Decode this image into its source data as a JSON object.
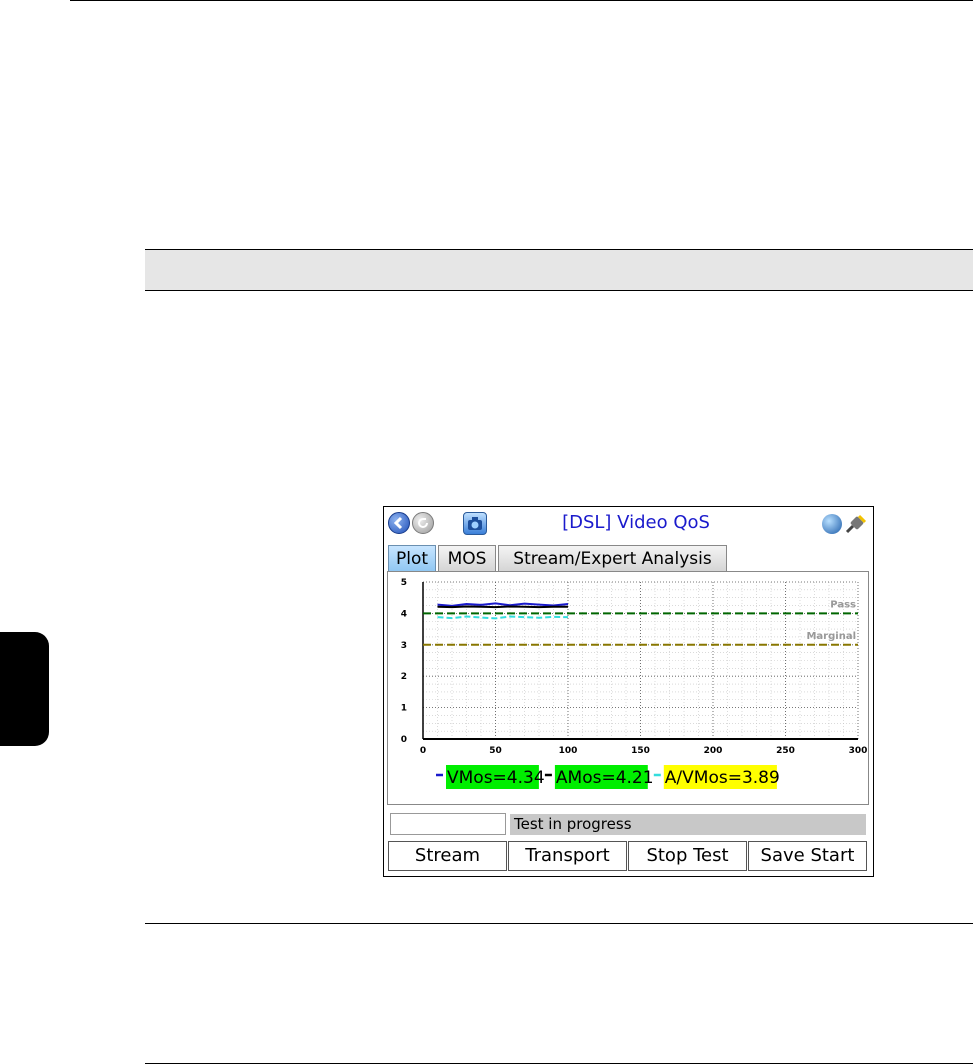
{
  "app": {
    "title": "[DSL] Video QoS",
    "icons": [
      "back-icon",
      "refresh-icon",
      "camera-icon",
      "globe-icon",
      "plug-icon"
    ]
  },
  "tabs": [
    {
      "label": "Plot",
      "active": true
    },
    {
      "label": "MOS",
      "active": false
    },
    {
      "label": "Stream/Expert Analysis",
      "active": false
    }
  ],
  "status": {
    "input_value": "",
    "message": "Test in progress"
  },
  "buttons": {
    "stream": "Stream",
    "transport": "Transport",
    "stop_test": "Stop Test",
    "save_start": "Save Start"
  },
  "legend": [
    {
      "label": "VMos=4.34",
      "swatch_color": "#1a1acc",
      "bg": "#00ee00"
    },
    {
      "label": "AMos=4.21",
      "swatch_color": "#000000",
      "bg": "#00ee00"
    },
    {
      "label": "A/VMos=3.89",
      "swatch_color": "#33dddd",
      "bg": "#ffff00"
    }
  ],
  "chart_data": {
    "type": "line",
    "title": "",
    "xlabel": "",
    "ylabel": "",
    "xlim": [
      0,
      300
    ],
    "ylim": [
      0,
      5
    ],
    "x_ticks": [
      0,
      50,
      100,
      150,
      200,
      250,
      300
    ],
    "y_ticks": [
      0,
      1,
      2,
      3,
      4,
      5
    ],
    "grid": true,
    "thresholds": [
      {
        "label": "Pass",
        "value": 4,
        "color": "#006600"
      },
      {
        "label": "Marginal",
        "value": 3,
        "color": "#887700"
      }
    ],
    "series": [
      {
        "name": "VMos",
        "color": "#1a1acc",
        "x": [
          10,
          20,
          30,
          40,
          50,
          60,
          70,
          80,
          90,
          100
        ],
        "y": [
          4.28,
          4.24,
          4.3,
          4.27,
          4.32,
          4.26,
          4.31,
          4.28,
          4.25,
          4.3
        ]
      },
      {
        "name": "AMos",
        "color": "#000000",
        "x": [
          10,
          20,
          30,
          40,
          50,
          60,
          70,
          80,
          90,
          100
        ],
        "y": [
          4.21,
          4.2,
          4.22,
          4.21,
          4.2,
          4.22,
          4.21,
          4.2,
          4.21,
          4.21
        ]
      },
      {
        "name": "A/VMos",
        "color": "#33dddd",
        "x": [
          10,
          20,
          30,
          40,
          50,
          60,
          70,
          80,
          90,
          100
        ],
        "y": [
          3.88,
          3.85,
          3.9,
          3.87,
          3.84,
          3.9,
          3.88,
          3.86,
          3.89,
          3.88
        ]
      }
    ]
  }
}
